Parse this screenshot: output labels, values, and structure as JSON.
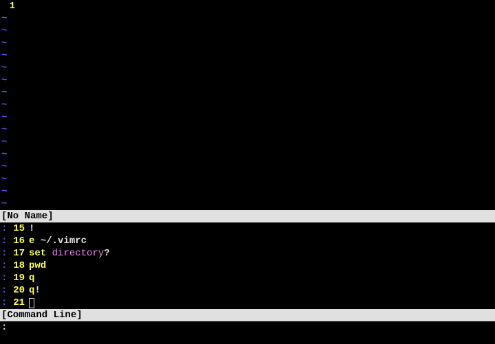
{
  "top_buffer": {
    "line_numbers": [
      "1"
    ],
    "tilde_count": 16,
    "tilde": "~",
    "status": "[No Name]"
  },
  "history": {
    "colon": ":",
    "lines": [
      {
        "num": "15",
        "tokens": [
          {
            "cls": "plain",
            "text": "!"
          }
        ]
      },
      {
        "num": "16",
        "tokens": [
          {
            "cls": "cmd",
            "text": "e"
          },
          {
            "cls": "plain",
            "text": " ~/.vimrc"
          }
        ]
      },
      {
        "num": "17",
        "tokens": [
          {
            "cls": "cmd",
            "text": "set"
          },
          {
            "cls": "plain",
            "text": " "
          },
          {
            "cls": "opt",
            "text": "directory"
          },
          {
            "cls": "plain",
            "text": "?"
          }
        ]
      },
      {
        "num": "18",
        "tokens": [
          {
            "cls": "cmd",
            "text": "pwd"
          }
        ]
      },
      {
        "num": "19",
        "tokens": [
          {
            "cls": "cmd",
            "text": "q"
          }
        ]
      },
      {
        "num": "20",
        "tokens": [
          {
            "cls": "cmd",
            "text": "q"
          },
          {
            "cls": "plain",
            "text": "!"
          }
        ]
      },
      {
        "num": "21",
        "tokens": [
          {
            "cls": "cursor",
            "text": ""
          }
        ]
      }
    ],
    "status": "[Command Line]"
  },
  "cmdline": ":"
}
